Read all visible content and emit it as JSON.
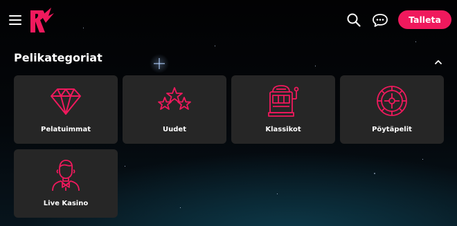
{
  "header": {
    "deposit_label": "Talleta",
    "icons": [
      "menu-icon",
      "logo-icon",
      "search-icon",
      "chat-icon"
    ]
  },
  "section": {
    "title": "Pelikategoriat",
    "collapse_icon": "chevron-up-icon"
  },
  "categories": [
    {
      "label": "Pelatuimmat",
      "icon": "diamond-icon"
    },
    {
      "label": "Uudet",
      "icon": "stars-icon"
    },
    {
      "label": "Klassikot",
      "icon": "slot-machine-icon"
    },
    {
      "label": "Pöytäpelit",
      "icon": "roulette-icon"
    },
    {
      "label": "Live Kasino",
      "icon": "dealer-icon"
    }
  ],
  "colors": {
    "accent": "#f0195d",
    "card_bg": "#262626",
    "background": "#020203"
  }
}
